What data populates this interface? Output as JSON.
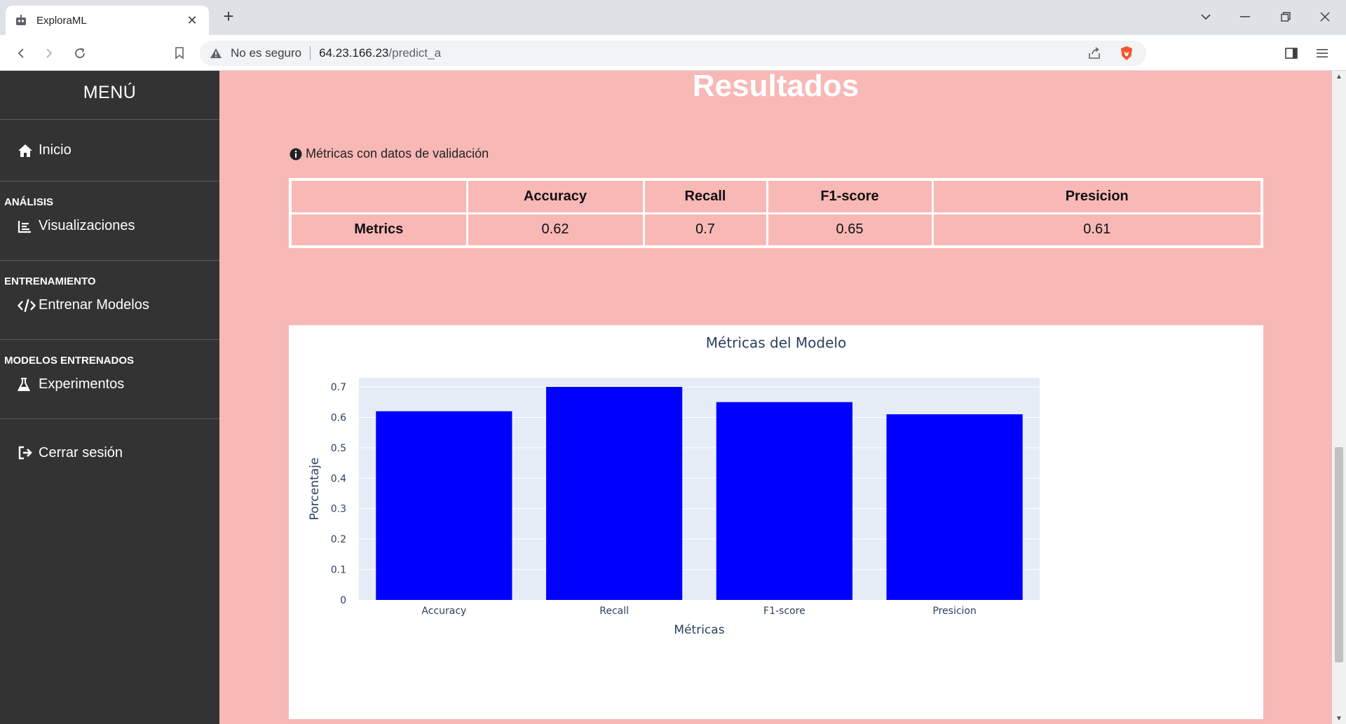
{
  "browser": {
    "tab_title": "ExploraML",
    "new_tab_label": "+",
    "security_label": "No es seguro",
    "url_host": "64.23.166.23",
    "url_path": "/predict_a"
  },
  "sidebar": {
    "menu_title": "MENÚ",
    "home_label": "Inicio",
    "sections": [
      {
        "heading": "ANÁLISIS",
        "item_label": "Visualizaciones"
      },
      {
        "heading": "ENTRENAMIENTO",
        "item_label": "Entrenar Modelos"
      },
      {
        "heading": "MODELOS ENTRENADOS",
        "item_label": "Experimentos"
      }
    ],
    "logout_label": "Cerrar sesión"
  },
  "main": {
    "title": "Resultados",
    "info_text": "Métricas con datos de validación",
    "table": {
      "headers": [
        "",
        "Accuracy",
        "Recall",
        "F1-score",
        "Presicion"
      ],
      "row_label": "Metrics",
      "values": [
        "0.62",
        "0.7",
        "0.65",
        "0.61"
      ]
    }
  },
  "colors": {
    "page_bg": "#f8b8b6",
    "sidebar_bg": "#333333",
    "bar_color": "#0000ff",
    "plot_bg": "#e5ecf6"
  },
  "chart_data": {
    "type": "bar",
    "title": "Métricas del Modelo",
    "xlabel": "Métricas",
    "ylabel": "Porcentaje",
    "categories": [
      "Accuracy",
      "Recall",
      "F1-score",
      "Presicion"
    ],
    "values": [
      0.62,
      0.7,
      0.65,
      0.61
    ],
    "ylim": [
      0,
      0.73
    ],
    "yticks": [
      0,
      0.1,
      0.2,
      0.3,
      0.4,
      0.5,
      0.6,
      0.7
    ],
    "ytick_labels": [
      "0",
      "0.1",
      "0.2",
      "0.3",
      "0.4",
      "0.5",
      "0.6",
      "0.7"
    ],
    "grid": true,
    "legend": "none"
  }
}
